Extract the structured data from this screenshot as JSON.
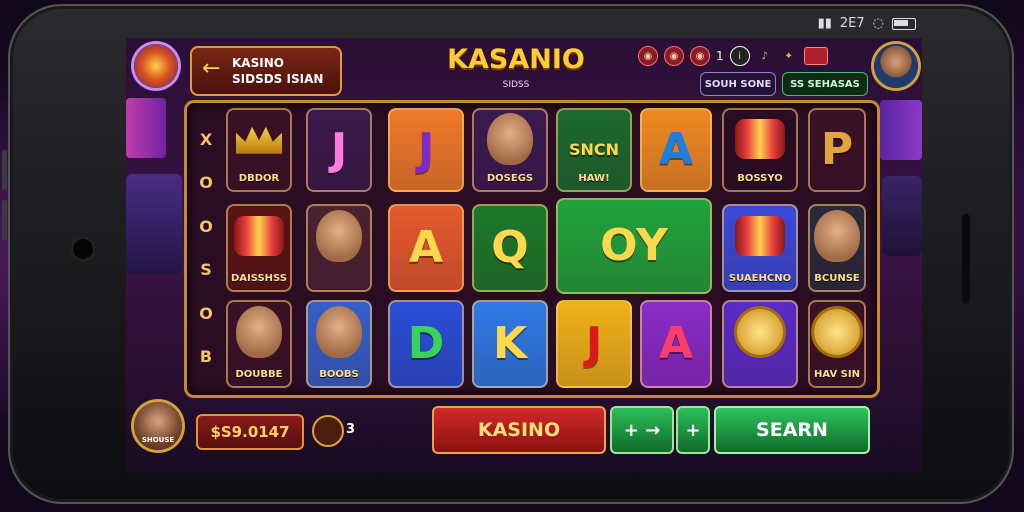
{
  "status_bar": {
    "time": "2E7"
  },
  "header": {
    "back_line1": "KASINO",
    "back_line2": "SIDSDS ISIAN",
    "title": "KASANIO",
    "subtitle": "SIDSS",
    "top_number": "1",
    "pill_left": "SOUH SONE",
    "pill_right": "SS SEHASAS"
  },
  "side_labels": [
    "X",
    "O",
    "O",
    "S",
    "O",
    "B"
  ],
  "tiles": [
    {
      "sym": "",
      "cap": "DBDOR",
      "bg": "#3b1226",
      "color": "#ffd84d",
      "kind": "crown"
    },
    {
      "sym": "J",
      "cap": "",
      "bg": "#3a1a4a",
      "color": "#ff7be0",
      "kind": "letter"
    },
    {
      "sym": "J",
      "cap": "",
      "bg": "#f07a2a",
      "color": "#7b2cc7",
      "kind": "letter"
    },
    {
      "sym": "",
      "cap": "DOSEGS",
      "bg": "#3b1a50",
      "color": "#ffd84d",
      "kind": "face"
    },
    {
      "sym": "SNCN",
      "cap": "HAW!",
      "bg": "#1c6a2e",
      "color": "#ffd84d",
      "kind": "text"
    },
    {
      "sym": "A",
      "cap": "",
      "bg": "#f08a22",
      "color": "#1b7fe0",
      "kind": "letter"
    },
    {
      "sym": "",
      "cap": "BOSSYO",
      "bg": "#2a0d22",
      "color": "#ffd84d",
      "kind": "drum"
    },
    {
      "sym": "P",
      "cap": "",
      "bg": "#3b1226",
      "color": "#e0a53c",
      "kind": "letter"
    },
    {
      "sym": "",
      "cap": "DAISSHSS",
      "bg": "#5a1414",
      "color": "#ffd84d",
      "kind": "drum"
    },
    {
      "sym": "",
      "cap": "",
      "bg": "#4a2230",
      "color": "#ffd84d",
      "kind": "face"
    },
    {
      "sym": "A",
      "cap": "",
      "bg": "#e65a2e",
      "color": "#ffd84d",
      "kind": "letter"
    },
    {
      "sym": "Q",
      "cap": "",
      "bg": "#1d7a2a",
      "color": "#ffd84d",
      "kind": "letter"
    },
    {
      "sym": "OY",
      "cap": "",
      "bg": "#21a43b",
      "color": "#ffd84d",
      "kind": "letter"
    },
    {
      "sym": "",
      "cap": "SUAEHCNO",
      "bg": "#3a4ad8",
      "color": "#ffd84d",
      "kind": "drum"
    },
    {
      "sym": "",
      "cap": "BCUNSE",
      "bg": "#2a2a3a",
      "color": "#ffffff",
      "kind": "face"
    },
    {
      "sym": "",
      "cap": "DOUBBE",
      "bg": "#3b1226",
      "color": "#ffd84d",
      "kind": "face"
    },
    {
      "sym": "",
      "cap": "BOOBS",
      "bg": "#3560c8",
      "color": "#ffd84d",
      "kind": "face"
    },
    {
      "sym": "D",
      "cap": "",
      "bg": "#2a4fd8",
      "color": "#3ad35a",
      "kind": "letter"
    },
    {
      "sym": "K",
      "cap": "",
      "bg": "#2f7ae6",
      "color": "#ffd84d",
      "kind": "letter"
    },
    {
      "sym": "J",
      "cap": "",
      "bg": "#f0b21a",
      "color": "#d81a1a",
      "kind": "letter"
    },
    {
      "sym": "A",
      "cap": "",
      "bg": "#8a2cc7",
      "color": "#ff3d6a",
      "kind": "letter"
    },
    {
      "sym": "",
      "cap": "",
      "bg": "#5a2cc7",
      "color": "#ffd84d",
      "kind": "coin"
    },
    {
      "sym": "",
      "cap": "HAV SIN",
      "bg": "#3b1226",
      "color": "#ffd84d",
      "kind": "coin"
    }
  ],
  "footer": {
    "avatar_caption": "SHOUSE",
    "balance": "$S9.0147",
    "coin_count": "3",
    "btn_kasino": "KASINO",
    "btn_green_small": "+ →",
    "btn_plus": "+",
    "btn_search": "SEARN"
  }
}
